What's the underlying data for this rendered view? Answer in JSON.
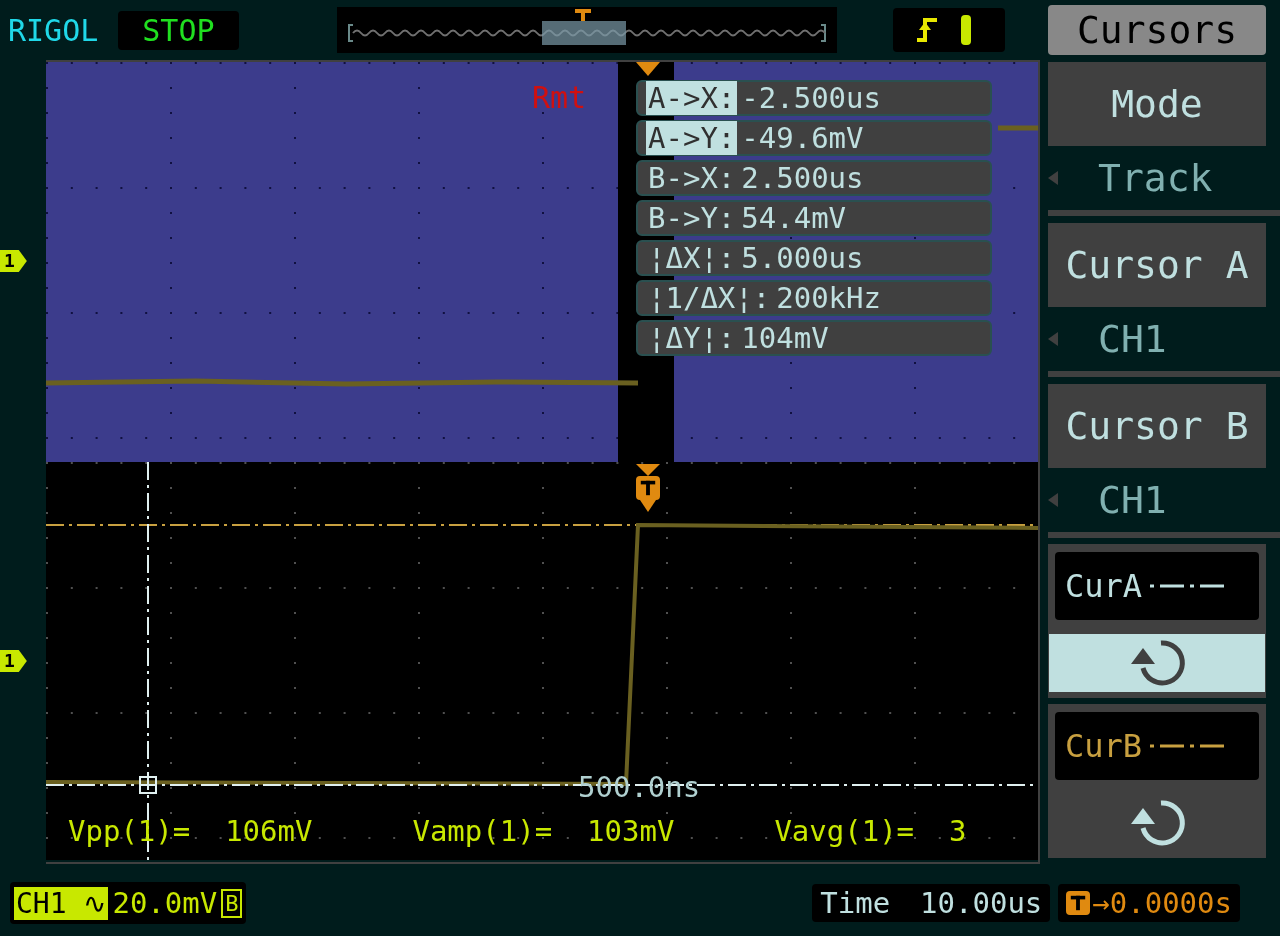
{
  "header": {
    "brand": "RIGOL",
    "run_state": "STOP"
  },
  "remote": "Rmt",
  "cursor_readouts": [
    {
      "label": "A->X:",
      "value": "-2.500us",
      "highlighted": true
    },
    {
      "label": "A->Y:",
      "value": "-49.6mV",
      "highlighted": true
    },
    {
      "label": "B->X:",
      "value": "2.500us",
      "highlighted": false
    },
    {
      "label": "B->Y:",
      "value": "54.4mV",
      "highlighted": false
    },
    {
      "label": "¦ΔX¦:",
      "value": "5.000us",
      "highlighted": false
    },
    {
      "label": "¦1/ΔX¦:",
      "value": "200kHz",
      "highlighted": false
    },
    {
      "label": "¦ΔY¦:",
      "value": "104mV",
      "highlighted": false
    }
  ],
  "cursor_time_label": "500.0ns",
  "measurements": [
    {
      "label": "Vpp(1)=",
      "value": "106mV"
    },
    {
      "label": "Vamp(1)=",
      "value": "103mV"
    },
    {
      "label": "Vavg(1)=",
      "value": "3"
    }
  ],
  "channel_markers": [
    "1",
    "1"
  ],
  "menu": {
    "title": "Cursors",
    "items": [
      {
        "kind": "option",
        "label": "Mode",
        "value": "Track"
      },
      {
        "kind": "option",
        "label": "Cursor A",
        "value": "CH1"
      },
      {
        "kind": "option",
        "label": "Cursor B",
        "value": "CH1"
      },
      {
        "kind": "cursor",
        "label": "CurA",
        "selected": true,
        "color": "#c0e0e0"
      },
      {
        "kind": "cursor",
        "label": "CurB",
        "selected": false,
        "color": "#c8a040"
      }
    ]
  },
  "status": {
    "channel": "CH1",
    "coupling": "∿",
    "scale": "20.0mV",
    "bw_limit": "B",
    "timebase_label": "Time",
    "timebase": "10.00us",
    "trigger_offset": "→0.0000s"
  }
}
